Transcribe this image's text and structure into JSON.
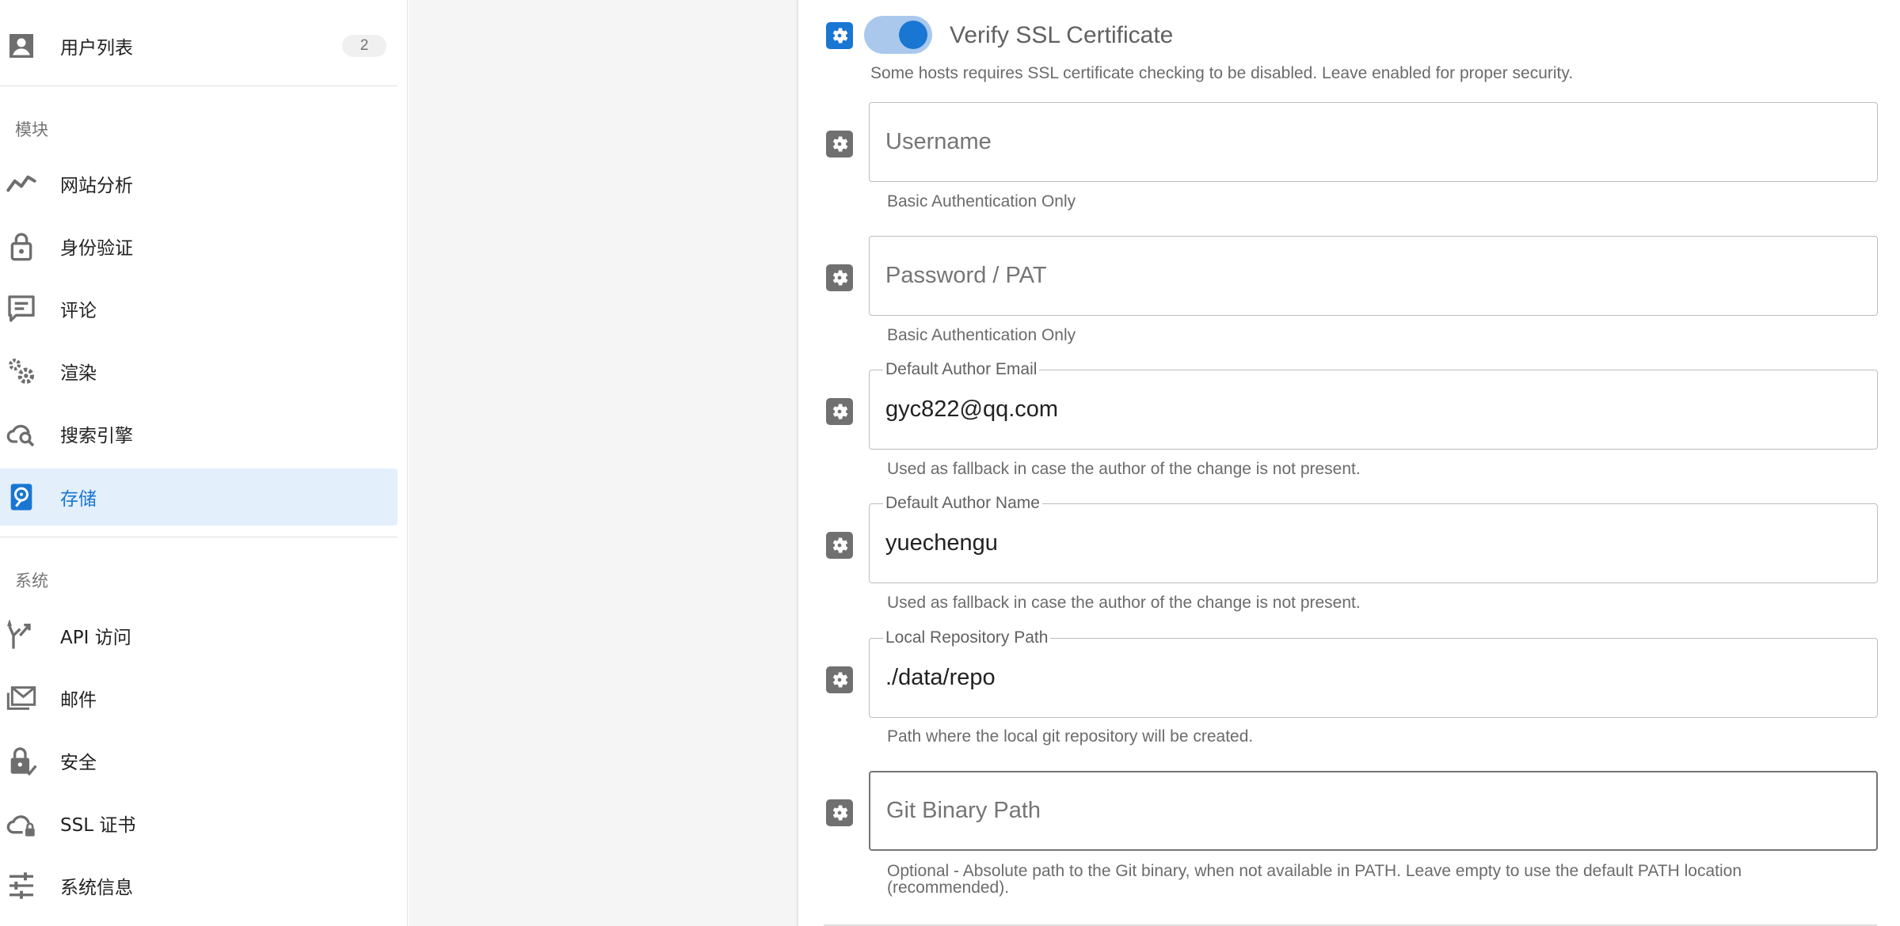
{
  "sidebar": {
    "top_item": {
      "label": "用户列表",
      "badge": "2",
      "icon": "account-box-icon"
    },
    "modules_header": "模块",
    "module_items": [
      {
        "label": "网站分析",
        "icon": "chart-line-icon"
      },
      {
        "label": "身份验证",
        "icon": "lock-icon"
      },
      {
        "label": "评论",
        "icon": "comment-icon"
      },
      {
        "label": "渲染",
        "icon": "cogs-icon"
      },
      {
        "label": "搜索引擎",
        "icon": "cloud-search-icon"
      },
      {
        "label": "存储",
        "icon": "harddisk-icon",
        "active": true
      }
    ],
    "system_header": "系统",
    "system_items": [
      {
        "label": "API 访问",
        "icon": "api-split-icon"
      },
      {
        "label": "邮件",
        "icon": "mail-icon"
      },
      {
        "label": "安全",
        "icon": "lock-check-icon"
      },
      {
        "label": "SSL 证书",
        "icon": "cloud-lock-icon"
      },
      {
        "label": "系统信息",
        "icon": "tune-sliders-icon"
      }
    ]
  },
  "form": {
    "verify_ssl": {
      "label": "Verify SSL Certificate",
      "enabled": true,
      "hint": "Some hosts requires SSL certificate checking to be disabled. Leave enabled for proper security."
    },
    "username": {
      "placeholder": "Username",
      "value": "",
      "hint": "Basic Authentication Only"
    },
    "password": {
      "placeholder": "Password / PAT",
      "value": "",
      "hint": "Basic Authentication Only"
    },
    "author_email": {
      "label": "Default Author Email",
      "value": "gyc822@qq.com",
      "hint": "Used as fallback in case the author of the change is not present."
    },
    "author_name": {
      "label": "Default Author Name",
      "value": "yuechengu",
      "hint": "Used as fallback in case the author of the change is not present."
    },
    "repo_path": {
      "label": "Local Repository Path",
      "value": "./data/repo",
      "hint": "Path where the local git repository will be created."
    },
    "git_binary": {
      "placeholder": "Git Binary Path",
      "value": "",
      "hint_line1": "Optional - Absolute path to the Git binary, when not available in PATH. Leave empty to use the default PATH location",
      "hint_line2": "(recommended)."
    }
  },
  "colors": {
    "accent": "#1976d2",
    "active_bg": "#e3effb",
    "icon_gray": "#707070",
    "toggle_track": "#a9c8ec"
  }
}
